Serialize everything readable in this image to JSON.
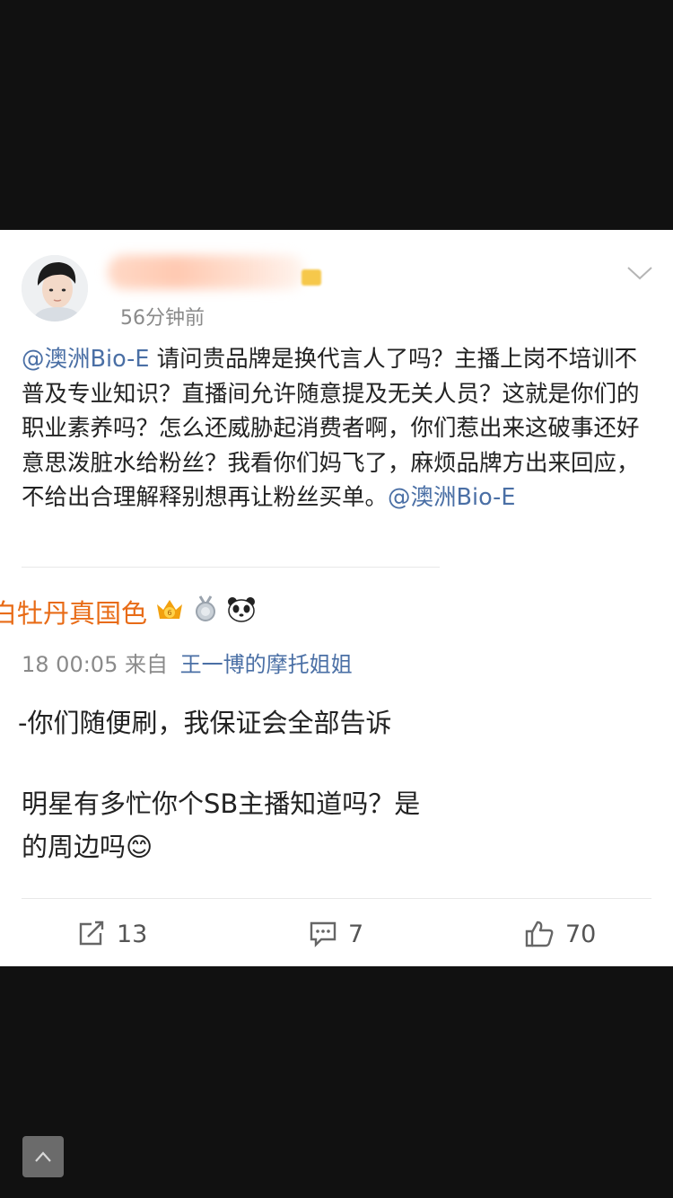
{
  "post": {
    "time": "56分钟前",
    "content_segments": [
      {
        "text": "@澳洲Bio-E",
        "type": "mention"
      },
      {
        "text": " 请问贵品牌是换代言人了吗？主播上岗不培训不普及专业知识？直播间允许随意提及无关人员？这就是你们的职业素养吗？怎么还威胁起消费者啊，你们惹出来这破事还好意思泼脏水给粉丝？我看你们妈飞了，麻烦品牌方出来回应，不给出合理解释别想再让粉丝买单。",
        "type": "text"
      },
      {
        "text": "@澳洲Bio-E",
        "type": "mention"
      }
    ]
  },
  "embedded": {
    "username": "白牡丹真国色",
    "meta_time": "18 00:05",
    "meta_from": "来自",
    "meta_source": "王一博的摩托姐姐",
    "line1": "-你们随便刷，我保证会全部告诉",
    "line2": "明星有多忙你个SB主播知道吗？是",
    "line3": "的周边吗😊"
  },
  "actions": {
    "repost_count": "13",
    "comment_count": "7",
    "like_count": "70"
  },
  "icons": {
    "more": "chevron-down-icon",
    "repost": "repost-icon",
    "comment": "comment-icon",
    "like": "thumbs-up-icon",
    "back_to_top": "arrow-up-icon"
  },
  "colors": {
    "mention": "#4a6fa5",
    "username": "#e86b16",
    "background": "#111111"
  }
}
